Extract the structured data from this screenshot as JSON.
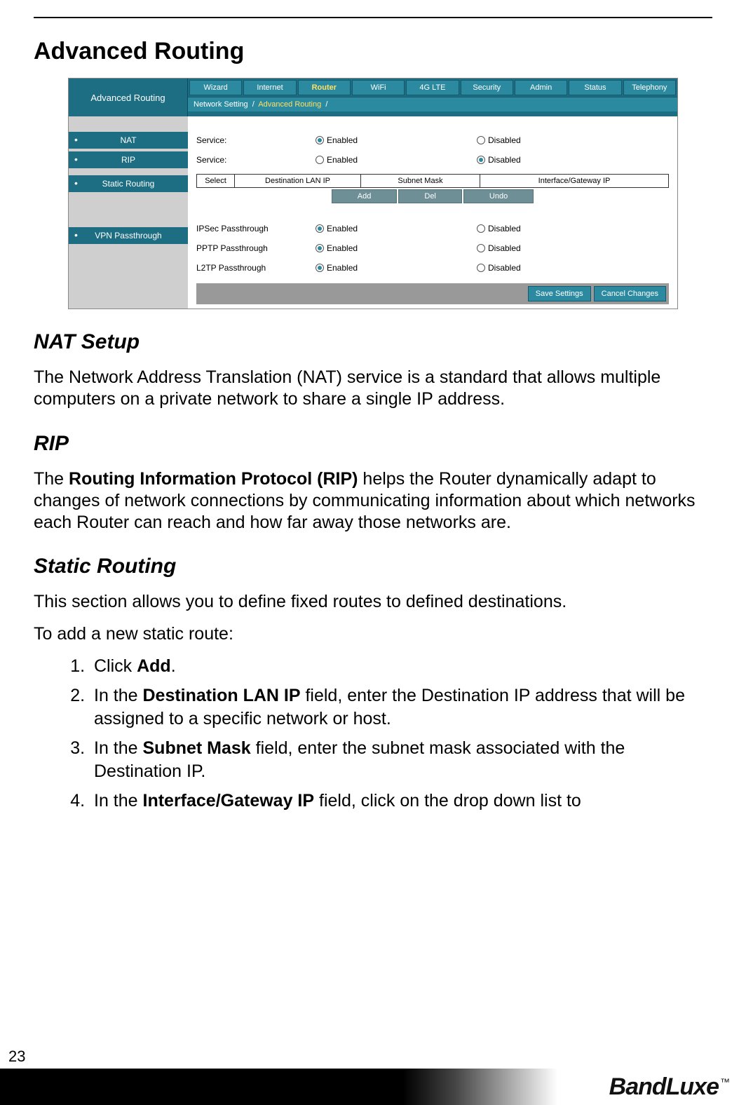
{
  "pageNumber": "23",
  "brand": "BandLuxe",
  "tm": "™",
  "doc": {
    "h1": "Advanced Routing",
    "nat_h": "NAT Setup",
    "nat_p": "The Network Address Translation (NAT) service is a standard that allows multiple computers on a private network to share a single IP address.",
    "rip_h": "RIP",
    "rip_p_pre": "The ",
    "rip_p_bold": "Routing Information Protocol (RIP)",
    "rip_p_post": " helps the Router dynamically adapt to changes of network connections by communicating information about which networks each Router can reach and how far away those networks are.",
    "sr_h": "Static Routing",
    "sr_p1": "This section allows you to define fixed routes to defined destinations.",
    "sr_p2": "To add a new static route:",
    "steps": {
      "s1_pre": "Click ",
      "s1_bold": "Add",
      "s1_post": ".",
      "s2_pre": "In the ",
      "s2_bold": "Destination LAN IP",
      "s2_post": " field, enter the Destination IP address that will be assigned to a specific network or host.",
      "s3_pre": "In the ",
      "s3_bold": "Subnet Mask",
      "s3_post": " field, enter the subnet mask associated with the Destination IP.",
      "s4_pre": "In the ",
      "s4_bold": "Interface/Gateway IP",
      "s4_post": " field, click on the drop down list to"
    }
  },
  "ui": {
    "title": "Advanced Routing",
    "tabs": [
      "Wizard",
      "Internet",
      "Router",
      "WiFi",
      "4G LTE",
      "Security",
      "Admin",
      "Status",
      "Telephony"
    ],
    "activeTab": "Router",
    "breadcrumb": {
      "a": "Network Setting",
      "b": "Advanced Routing"
    },
    "side": [
      "NAT",
      "RIP",
      "Static Routing",
      "VPN Passthrough"
    ],
    "rows": {
      "nat_label": "Service:",
      "rip_label": "Service:",
      "enabled": "Enabled",
      "disabled": "Disabled",
      "ipsec": "IPSec Passthrough",
      "pptp": "PPTP Passthrough",
      "l2tp": "L2TP Passthrough"
    },
    "table": {
      "select": "Select",
      "dest": "Destination LAN IP",
      "mask": "Subnet Mask",
      "if": "Interface/Gateway IP"
    },
    "btns": {
      "add": "Add",
      "del": "Del",
      "undo": "Undo"
    },
    "footer": {
      "save": "Save Settings",
      "cancel": "Cancel Changes"
    }
  }
}
